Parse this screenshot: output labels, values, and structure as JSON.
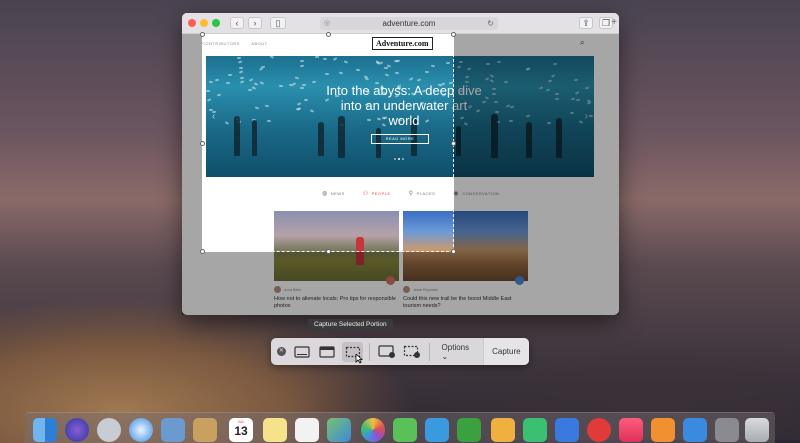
{
  "browser": {
    "url": "adventure.com",
    "back_icon": "chevron-left-icon",
    "forward_icon": "chevron-right-icon"
  },
  "site": {
    "nav_links": [
      "CONTRIBUTORS",
      "ABOUT"
    ],
    "logo": "Adventure.com",
    "hero": {
      "title": "Into the abyss: A deep dive into an underwater art world",
      "button": "READ MORE"
    },
    "categories": [
      {
        "label": "NEWS",
        "icon": "globe-icon",
        "color": "#777777"
      },
      {
        "label": "PEOPLE",
        "icon": "people-icon",
        "color": "#d9534f"
      },
      {
        "label": "PLACES",
        "icon": "pin-icon",
        "color": "#777777"
      },
      {
        "label": "CONSERVATION",
        "icon": "eye-icon",
        "color": "#777777"
      }
    ],
    "cards": [
      {
        "author": "Anna Bella",
        "title": "How not to alienate locals: Pro tips for responsible photos"
      },
      {
        "author": "Jesse Reynolds",
        "title": "Could this new trail be the boost Middle East tourism needs?"
      }
    ]
  },
  "screenshot_toolbar": {
    "tooltip": "Capture Selected Portion",
    "options_label": "Options",
    "capture_label": "Capture",
    "tools": [
      "capture-entire-screen",
      "capture-selected-window",
      "capture-selected-portion",
      "record-entire-screen",
      "record-selected-portion"
    ],
    "active_tool": "capture-selected-portion"
  },
  "dock": {
    "calendar_month": "JUL",
    "calendar_day": "13"
  }
}
